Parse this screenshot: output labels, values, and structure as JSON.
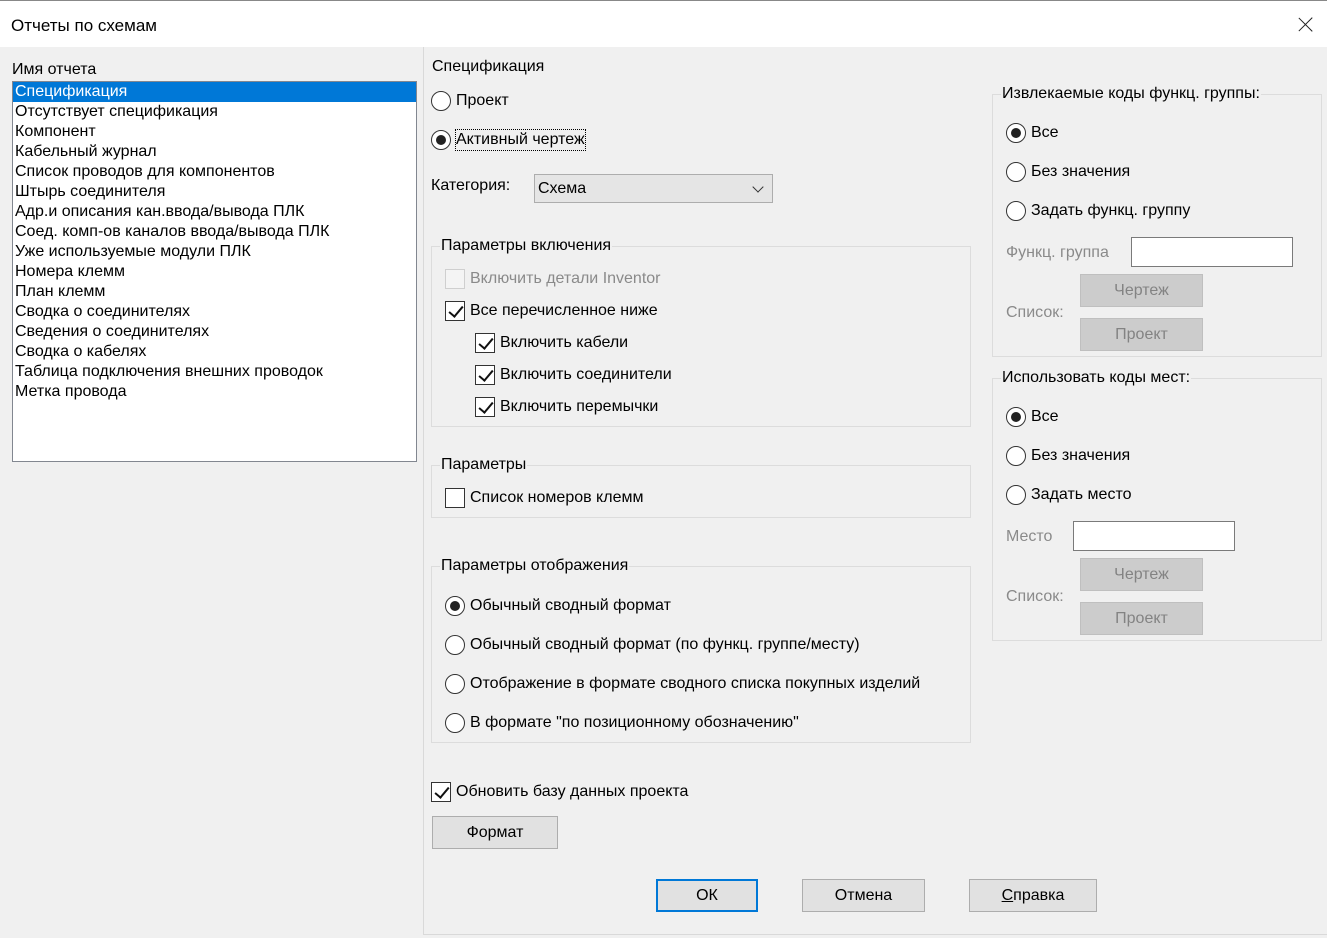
{
  "window": {
    "title": "Отчеты по схемам"
  },
  "report_list": {
    "label": "Имя отчета",
    "items": [
      "Спецификация",
      "Отсутствует спецификация",
      "Компонент",
      "Кабельный журнал",
      "Список проводов для компонентов",
      "Штырь соединителя",
      "Адр.и описания кан.ввода/вывода ПЛК",
      "Соед. комп-ов каналов ввода/вывода ПЛК",
      "Уже используемые модули ПЛК",
      "Номера клемм",
      "План клемм",
      "Сводка о соединителях",
      "Сведения о соединителях",
      "Сводка о кабелях",
      "Таблица подключения внешних проводок",
      "Метка провода"
    ],
    "selected": "Спецификация"
  },
  "spec": {
    "title": "Спецификация",
    "project": "Проект",
    "active_drawing": "Активный чертеж",
    "selected": "Активный чертеж"
  },
  "category": {
    "label": "Категория:",
    "value": "Схема"
  },
  "include_params": {
    "title": "Параметры включения",
    "inventor": "Включить детали Inventor",
    "all_below": "Все перечисленное ниже",
    "cables": "Включить кабели",
    "connectors": "Включить соединители",
    "jumpers": "Включить перемычки"
  },
  "params": {
    "title": "Параметры",
    "terminal_numbers": "Список номеров клемм"
  },
  "display_params": {
    "title": "Параметры отображения",
    "opt1": "Обычный сводный формат",
    "opt2": "Обычный сводный формат (по функц. группе/месту)",
    "opt3": "Отображение в формате сводного списка покупных изделий",
    "opt4": "В формате \"по позиционному обозначению\"",
    "selected": "Обычный сводный формат"
  },
  "update_db": "Обновить базу данных проекта",
  "format_button": "Формат",
  "func_group_codes": {
    "title": "Извлекаемые коды функц. группы:",
    "all": "Все",
    "no_value": "Без значения",
    "set": "Задать функц. группу",
    "field_label": "Функц. группа",
    "field_value": "",
    "list_label": "Список:",
    "drawing_button": "Чертеж",
    "project_button": "Проект",
    "selected": "Все"
  },
  "location_codes": {
    "title": "Использовать коды мест:",
    "all": "Все",
    "no_value": "Без значения",
    "set": "Задать место",
    "field_label": "Место",
    "field_value": "",
    "list_label": "Список:",
    "drawing_button": "Чертеж",
    "project_button": "Проект",
    "selected": "Все"
  },
  "buttons": {
    "ok": "ОК",
    "cancel": "Отмена",
    "help_first": "С",
    "help_rest": "правка"
  }
}
